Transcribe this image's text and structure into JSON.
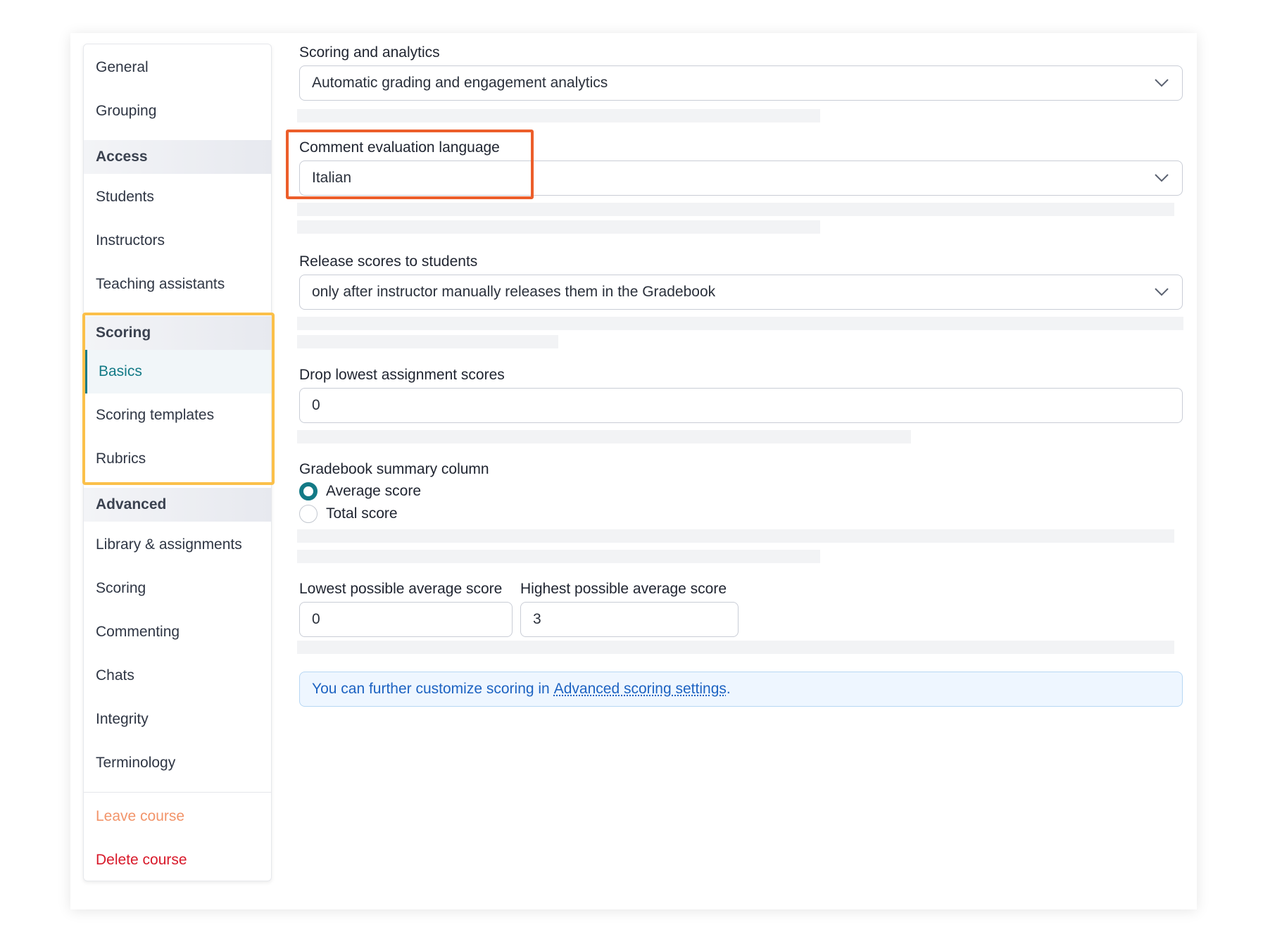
{
  "sidebar": {
    "general": "General",
    "grouping": "Grouping",
    "access_header": "Access",
    "students": "Students",
    "instructors": "Instructors",
    "teaching_assistants": "Teaching assistants",
    "scoring_header": "Scoring",
    "basics": "Basics",
    "scoring_templates": "Scoring templates",
    "rubrics": "Rubrics",
    "advanced_header": "Advanced",
    "library_assignments": "Library & assignments",
    "scoring": "Scoring",
    "commenting": "Commenting",
    "chats": "Chats",
    "integrity": "Integrity",
    "terminology": "Terminology",
    "leave_course": "Leave course",
    "delete_course": "Delete course"
  },
  "form": {
    "scoring_analytics": {
      "label": "Scoring and analytics",
      "value": "Automatic grading and engagement analytics"
    },
    "comment_language": {
      "label": "Comment evaluation language",
      "value": "Italian"
    },
    "release_scores": {
      "label": "Release scores to students",
      "value": "only after instructor manually releases them in the Gradebook"
    },
    "drop_lowest": {
      "label": "Drop lowest assignment scores",
      "value": "0"
    },
    "summary_column": {
      "label": "Gradebook summary column",
      "options": [
        "Average score",
        "Total score"
      ],
      "selected": "Average score"
    },
    "lowest_avg": {
      "label": "Lowest possible average score",
      "value": "0"
    },
    "highest_avg": {
      "label": "Highest possible average score",
      "value": "3"
    },
    "info": {
      "text": "You can further customize scoring in",
      "link": "Advanced scoring settings",
      "suffix": "."
    }
  },
  "colors": {
    "accent": "#137a86",
    "scoring_highlight": "#fbc04a",
    "language_highlight": "#ec5e2a",
    "leave": "#f2946a",
    "delete": "#d8192a",
    "info_text": "#1d63c2"
  },
  "icons": {
    "select_arrow": "chevron-down-icon"
  }
}
